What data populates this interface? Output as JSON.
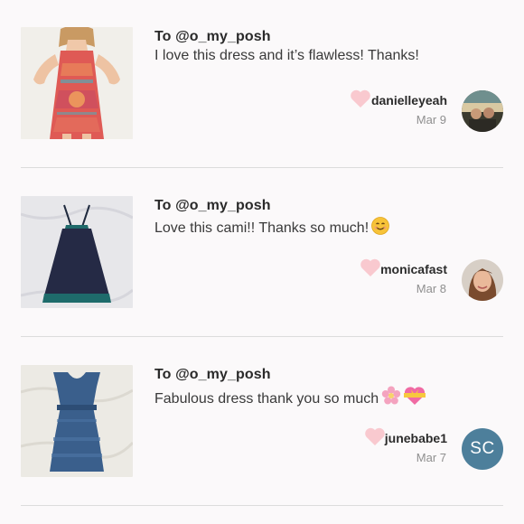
{
  "brand_colors": {
    "background": "#fbf9fa",
    "heart": "#f9c9cf",
    "divider": "#dcdcdc",
    "avatar_initials_bg": "#4d7f9b"
  },
  "feed": {
    "items": [
      {
        "to": "To @o_my_posh",
        "message": "I love this dress and it’s flawless! Thanks!",
        "emoji": [],
        "username": "danielleyeah",
        "date": "Mar 9",
        "thumbnail_icon": "red-print-dress-photo",
        "avatar_icon": "photo-avatar-icon"
      },
      {
        "to": "To @o_my_posh",
        "message": "Love this cami!! Thanks so much!",
        "emoji": [
          "smiling-face-emoji"
        ],
        "username": "monicafast",
        "date": "Mar 8",
        "thumbnail_icon": "navy-cami-photo",
        "avatar_icon": "photo-avatar-icon"
      },
      {
        "to": "To @o_my_posh",
        "message": "Fabulous dress thank you so much",
        "emoji": [
          "cherry-blossom-emoji",
          "heart-with-ribbon-emoji"
        ],
        "username": "junebabe1",
        "date": "Mar 7",
        "thumbnail_icon": "blue-lace-dress-photo",
        "avatar_initials": "SC"
      }
    ]
  }
}
